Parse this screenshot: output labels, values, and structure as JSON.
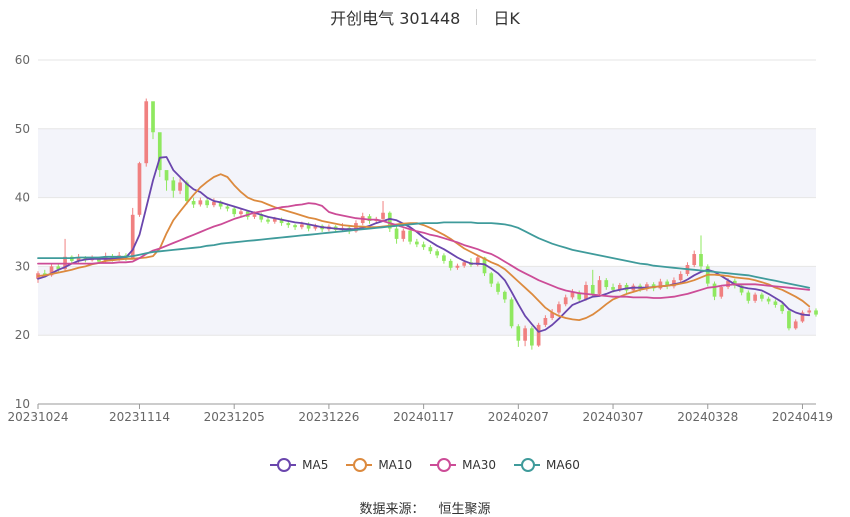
{
  "chart_data": {
    "type": "candlestick",
    "title": "开创电气 301448",
    "subtitle": "日K",
    "ylim": [
      10,
      60
    ],
    "yticks": [
      10,
      20,
      30,
      40,
      50,
      60
    ],
    "xtick_labels": [
      "20231024",
      "20231114",
      "20231205",
      "20231226",
      "20240117",
      "20240207",
      "20240307",
      "20240328",
      "20240419"
    ],
    "xtick_index": [
      0,
      15,
      29,
      43,
      57,
      71,
      85,
      99,
      113
    ],
    "up_color": "#f08080",
    "down_color": "#8fe860",
    "legend_position": "bottom",
    "candles": [
      [
        28.2,
        29.0,
        27.6,
        29.3
      ],
      [
        29.0,
        28.7,
        28.4,
        29.5
      ],
      [
        28.7,
        30.0,
        28.5,
        30.4
      ],
      [
        30.0,
        29.6,
        29.2,
        30.3
      ],
      [
        29.6,
        31.4,
        29.4,
        34.0
      ],
      [
        31.4,
        30.8,
        30.3,
        31.6
      ],
      [
        30.8,
        31.3,
        30.5,
        31.8
      ],
      [
        31.3,
        30.9,
        30.6,
        31.5
      ],
      [
        30.9,
        31.2,
        30.7,
        31.6
      ],
      [
        31.2,
        30.7,
        30.4,
        31.4
      ],
      [
        30.7,
        31.5,
        30.5,
        32.0
      ],
      [
        31.5,
        31.0,
        30.7,
        31.8
      ],
      [
        31.0,
        31.6,
        30.8,
        32.1
      ],
      [
        31.6,
        31.1,
        30.8,
        31.9
      ],
      [
        31.1,
        37.5,
        31.0,
        38.5
      ],
      [
        37.5,
        45.0,
        37.2,
        45.2
      ],
      [
        45.0,
        54.0,
        44.5,
        54.4
      ],
      [
        54.0,
        49.5,
        48.5,
        51.5
      ],
      [
        49.5,
        44.0,
        43.0,
        46.0
      ],
      [
        44.0,
        42.5,
        41.0,
        43.5
      ],
      [
        42.5,
        41.0,
        40.0,
        43.0
      ],
      [
        41.0,
        42.2,
        40.5,
        42.8
      ],
      [
        42.2,
        39.5,
        39.0,
        42.5
      ],
      [
        39.5,
        39.0,
        38.5,
        40.0
      ],
      [
        39.0,
        39.6,
        38.7,
        40.0
      ],
      [
        39.6,
        38.9,
        38.5,
        40.1
      ],
      [
        38.9,
        39.4,
        38.6,
        39.9
      ],
      [
        39.4,
        38.7,
        38.3,
        39.6
      ],
      [
        38.7,
        38.4,
        38.0,
        39.1
      ],
      [
        38.4,
        37.6,
        37.2,
        38.8
      ],
      [
        37.6,
        38.0,
        37.3,
        38.4
      ],
      [
        38.0,
        37.2,
        36.8,
        38.2
      ],
      [
        37.2,
        37.6,
        36.9,
        38.0
      ],
      [
        37.6,
        36.8,
        36.4,
        37.8
      ],
      [
        36.8,
        36.5,
        36.2,
        37.2
      ],
      [
        36.5,
        36.9,
        36.2,
        37.2
      ],
      [
        36.9,
        36.3,
        35.9,
        37.1
      ],
      [
        36.3,
        36.0,
        35.6,
        36.6
      ],
      [
        36.0,
        35.7,
        35.3,
        36.2
      ],
      [
        35.7,
        36.1,
        35.4,
        36.5
      ],
      [
        36.1,
        35.5,
        35.1,
        36.4
      ],
      [
        35.5,
        35.9,
        35.2,
        36.2
      ],
      [
        35.9,
        35.4,
        35.0,
        36.1
      ],
      [
        35.4,
        35.8,
        35.1,
        36.1
      ],
      [
        35.8,
        35.3,
        34.9,
        36.0
      ],
      [
        35.3,
        35.6,
        35.0,
        36.3
      ],
      [
        35.6,
        35.1,
        34.7,
        35.8
      ],
      [
        35.1,
        36.3,
        34.9,
        36.7
      ],
      [
        36.3,
        37.3,
        36.0,
        37.8
      ],
      [
        37.3,
        36.6,
        36.2,
        37.6
      ],
      [
        36.6,
        36.9,
        36.3,
        37.2
      ],
      [
        36.9,
        37.8,
        36.6,
        39.5
      ],
      [
        37.8,
        35.5,
        35.0,
        38.0
      ],
      [
        35.5,
        34.0,
        33.3,
        35.8
      ],
      [
        34.0,
        35.2,
        33.6,
        35.5
      ],
      [
        35.2,
        33.6,
        33.2,
        35.4
      ],
      [
        33.6,
        33.2,
        32.8,
        34.0
      ],
      [
        33.2,
        32.8,
        32.4,
        33.6
      ],
      [
        32.8,
        32.2,
        31.8,
        33.1
      ],
      [
        32.2,
        31.6,
        31.2,
        32.5
      ],
      [
        31.6,
        30.8,
        30.4,
        31.9
      ],
      [
        30.8,
        29.8,
        29.4,
        31.1
      ],
      [
        29.8,
        30.1,
        29.5,
        30.4
      ],
      [
        30.1,
        30.6,
        29.8,
        30.9
      ],
      [
        30.6,
        30.2,
        29.9,
        31.2
      ],
      [
        30.2,
        31.3,
        30.0,
        31.6
      ],
      [
        31.3,
        29.0,
        28.6,
        31.4
      ],
      [
        29.0,
        27.5,
        27.0,
        29.2
      ],
      [
        27.5,
        26.3,
        25.9,
        27.8
      ],
      [
        26.3,
        25.2,
        24.7,
        26.5
      ],
      [
        25.2,
        21.3,
        21.0,
        25.5
      ],
      [
        21.3,
        19.2,
        18.3,
        21.6
      ],
      [
        19.2,
        21.0,
        18.4,
        21.4
      ],
      [
        21.0,
        18.5,
        17.9,
        21.3
      ],
      [
        18.5,
        21.5,
        18.3,
        21.8
      ],
      [
        21.5,
        22.5,
        21.2,
        22.9
      ],
      [
        22.5,
        23.3,
        22.2,
        23.8
      ],
      [
        23.3,
        24.5,
        23.0,
        24.9
      ],
      [
        24.5,
        25.5,
        24.2,
        25.9
      ],
      [
        25.5,
        26.2,
        25.2,
        26.7
      ],
      [
        26.2,
        25.2,
        24.8,
        26.5
      ],
      [
        25.2,
        27.3,
        25.0,
        27.8
      ],
      [
        27.3,
        26.0,
        25.6,
        29.5
      ],
      [
        26.0,
        28.0,
        25.8,
        28.6
      ],
      [
        28.0,
        27.0,
        26.6,
        28.3
      ],
      [
        27.0,
        26.6,
        26.2,
        27.5
      ],
      [
        26.6,
        27.3,
        26.3,
        27.6
      ],
      [
        27.3,
        26.5,
        26.1,
        27.6
      ],
      [
        26.5,
        27.2,
        26.2,
        27.5
      ],
      [
        27.2,
        26.7,
        26.3,
        27.5
      ],
      [
        26.7,
        27.4,
        26.4,
        27.7
      ],
      [
        27.4,
        26.8,
        26.4,
        27.7
      ],
      [
        26.8,
        27.8,
        26.6,
        28.2
      ],
      [
        27.8,
        27.1,
        26.7,
        28.1
      ],
      [
        27.1,
        28.0,
        26.8,
        28.4
      ],
      [
        28.0,
        28.9,
        27.7,
        29.3
      ],
      [
        28.9,
        30.2,
        28.6,
        30.6
      ],
      [
        30.2,
        31.8,
        29.9,
        32.3
      ],
      [
        31.8,
        30.0,
        29.6,
        34.5
      ],
      [
        30.0,
        27.5,
        27.1,
        30.3
      ],
      [
        27.5,
        25.6,
        25.1,
        27.8
      ],
      [
        25.6,
        27.0,
        25.3,
        27.3
      ],
      [
        27.0,
        27.9,
        26.7,
        28.3
      ],
      [
        27.9,
        27.2,
        26.8,
        28.2
      ],
      [
        27.2,
        26.2,
        25.8,
        27.5
      ],
      [
        26.2,
        25.0,
        24.6,
        26.5
      ],
      [
        25.0,
        25.9,
        24.7,
        26.2
      ],
      [
        25.9,
        25.3,
        24.9,
        26.2
      ],
      [
        25.3,
        24.9,
        24.5,
        25.6
      ],
      [
        24.9,
        24.4,
        24.0,
        25.2
      ],
      [
        24.4,
        23.5,
        23.1,
        24.7
      ],
      [
        23.5,
        21.0,
        20.7,
        23.8
      ],
      [
        21.0,
        22.0,
        20.8,
        22.3
      ],
      [
        22.0,
        23.3,
        21.8,
        23.6
      ],
      [
        23.3,
        23.6,
        23.0,
        24.0
      ],
      [
        23.6,
        23.0,
        22.7,
        23.9
      ]
    ],
    "series": [
      {
        "name": "MA5",
        "color": "#6a46ad",
        "values": [
          28.2,
          28.5,
          29.0,
          29.5,
          29.9,
          30.4,
          30.8,
          31.0,
          31.1,
          31.1,
          31.1,
          31.1,
          31.2,
          31.3,
          32.4,
          34.6,
          38.5,
          42.5,
          45.8,
          45.9,
          44.0,
          43.0,
          42.0,
          41.2,
          40.8,
          40.0,
          39.5,
          39.3,
          39.0,
          38.7,
          38.4,
          38.1,
          37.8,
          37.5,
          37.2,
          37.0,
          36.8,
          36.6,
          36.4,
          36.3,
          36.1,
          35.9,
          35.7,
          35.6,
          35.5,
          35.4,
          35.4,
          35.4,
          35.6,
          35.9,
          36.3,
          36.6,
          36.9,
          36.7,
          36.2,
          35.7,
          35.0,
          34.2,
          33.6,
          33.0,
          32.5,
          31.9,
          31.3,
          30.8,
          30.4,
          30.4,
          30.3,
          29.7,
          29.0,
          28.0,
          26.3,
          24.5,
          22.8,
          21.6,
          20.5,
          20.8,
          21.5,
          22.4,
          23.4,
          24.4,
          24.8,
          25.2,
          25.6,
          25.7,
          26.0,
          26.4,
          26.6,
          26.8,
          26.9,
          26.9,
          26.9,
          27.0,
          27.1,
          27.2,
          27.4,
          27.6,
          28.1,
          28.7,
          29.2,
          29.5,
          29.2,
          28.6,
          28.0,
          27.4,
          27.0,
          26.8,
          26.7,
          26.5,
          26.0,
          25.4,
          24.8,
          23.8,
          23.3,
          23.0,
          22.9
        ]
      },
      {
        "name": "MA10",
        "color": "#dc8a3e",
        "values": [
          28.6,
          28.7,
          28.9,
          29.1,
          29.3,
          29.5,
          29.8,
          30.0,
          30.3,
          30.5,
          30.8,
          30.9,
          31.0,
          31.1,
          31.1,
          31.2,
          31.3,
          31.5,
          32.6,
          34.8,
          36.7,
          38.0,
          39.2,
          40.4,
          41.5,
          42.3,
          43.0,
          43.4,
          43.0,
          41.8,
          40.8,
          40.0,
          39.6,
          39.4,
          39.0,
          38.6,
          38.3,
          38.0,
          37.7,
          37.4,
          37.1,
          36.9,
          36.6,
          36.4,
          36.2,
          36.0,
          35.9,
          35.8,
          35.8,
          35.7,
          35.7,
          35.8,
          35.9,
          36.1,
          36.2,
          36.3,
          36.3,
          36.0,
          35.6,
          35.1,
          34.6,
          34.0,
          33.3,
          32.6,
          32.1,
          31.6,
          31.1,
          30.6,
          30.2,
          29.6,
          28.7,
          27.8,
          26.9,
          26.0,
          25.0,
          24.0,
          23.3,
          22.8,
          22.5,
          22.3,
          22.2,
          22.5,
          23.0,
          23.7,
          24.5,
          25.2,
          25.6,
          26.0,
          26.3,
          26.6,
          26.8,
          27.0,
          27.1,
          27.2,
          27.3,
          27.5,
          27.7,
          28.0,
          28.4,
          28.8,
          28.8,
          28.7,
          28.6,
          28.4,
          28.3,
          28.2,
          28.0,
          27.7,
          27.4,
          26.9,
          26.6,
          26.1,
          25.6,
          25.0,
          24.2
        ]
      },
      {
        "name": "MA30",
        "color": "#cc4c97",
        "values": [
          30.4,
          30.4,
          30.4,
          30.4,
          30.4,
          30.4,
          30.4,
          30.4,
          30.4,
          30.5,
          30.5,
          30.5,
          30.6,
          30.6,
          30.7,
          31.2,
          31.8,
          32.3,
          32.6,
          33.0,
          33.4,
          33.8,
          34.2,
          34.6,
          35.0,
          35.4,
          35.8,
          36.1,
          36.5,
          36.9,
          37.2,
          37.5,
          37.8,
          38.0,
          38.2,
          38.4,
          38.6,
          38.7,
          38.9,
          39.0,
          39.2,
          39.1,
          38.8,
          37.9,
          37.6,
          37.4,
          37.2,
          37.0,
          36.9,
          36.8,
          36.8,
          36.6,
          36.3,
          36.0,
          35.7,
          35.4,
          35.1,
          34.9,
          34.6,
          34.4,
          34.1,
          33.8,
          33.5,
          33.1,
          32.8,
          32.5,
          32.1,
          31.8,
          31.3,
          30.7,
          30.1,
          29.5,
          29.0,
          28.5,
          28.0,
          27.6,
          27.2,
          26.8,
          26.5,
          26.3,
          26.1,
          26.0,
          25.9,
          25.8,
          25.7,
          25.6,
          25.6,
          25.6,
          25.5,
          25.5,
          25.5,
          25.4,
          25.4,
          25.5,
          25.6,
          25.8,
          26.0,
          26.3,
          26.6,
          26.9,
          27.0,
          27.2,
          27.3,
          27.4,
          27.4,
          27.4,
          27.4,
          27.3,
          27.2,
          27.1,
          27.0,
          26.9,
          26.8,
          26.7,
          26.6
        ]
      },
      {
        "name": "MA60",
        "color": "#3f9b9b",
        "values": [
          31.2,
          31.2,
          31.2,
          31.2,
          31.2,
          31.2,
          31.3,
          31.3,
          31.3,
          31.3,
          31.4,
          31.4,
          31.4,
          31.4,
          31.5,
          31.7,
          31.9,
          32.1,
          32.2,
          32.3,
          32.4,
          32.5,
          32.6,
          32.7,
          32.8,
          33.0,
          33.1,
          33.3,
          33.4,
          33.5,
          33.6,
          33.7,
          33.8,
          33.9,
          34.0,
          34.1,
          34.2,
          34.3,
          34.4,
          34.5,
          34.6,
          34.7,
          34.8,
          34.9,
          35.0,
          35.1,
          35.2,
          35.3,
          35.4,
          35.5,
          35.6,
          35.7,
          35.8,
          35.9,
          36.0,
          36.1,
          36.2,
          36.3,
          36.3,
          36.3,
          36.4,
          36.4,
          36.4,
          36.4,
          36.4,
          36.3,
          36.3,
          36.3,
          36.2,
          36.1,
          35.9,
          35.6,
          35.1,
          34.6,
          34.1,
          33.7,
          33.3,
          33.0,
          32.7,
          32.4,
          32.2,
          32.0,
          31.8,
          31.6,
          31.4,
          31.2,
          31.0,
          30.8,
          30.6,
          30.4,
          30.3,
          30.1,
          30.0,
          29.9,
          29.8,
          29.7,
          29.6,
          29.5,
          29.4,
          29.3,
          29.2,
          29.1,
          29.0,
          28.9,
          28.8,
          28.7,
          28.5,
          28.3,
          28.1,
          27.9,
          27.7,
          27.5,
          27.3,
          27.1,
          26.9
        ]
      }
    ]
  },
  "source": {
    "label": "数据来源：",
    "value": "恒生聚源"
  }
}
